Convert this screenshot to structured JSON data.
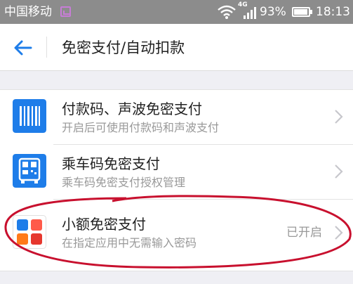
{
  "status_bar": {
    "carrier": "中国移动",
    "network": "4G",
    "battery": "93%",
    "battery_level": 0.93,
    "time": "18:13",
    "icons": [
      "app-notification-icon",
      "wifi-icon",
      "cell-signal-icon",
      "battery-icon"
    ]
  },
  "header": {
    "back_icon": "back-arrow-icon",
    "title": "免密支付/自动扣款"
  },
  "rows": [
    {
      "icon": "barcode-icon",
      "title": "付款码、声波免密支付",
      "subtitle": "开启后可使用付款码和声波支付",
      "status": ""
    },
    {
      "icon": "bus-code-icon",
      "title": "乘车码免密支付",
      "subtitle": "乘车码免密支付授权管理",
      "status": ""
    },
    {
      "icon": "app-grid-icon",
      "title": "小额免密支付",
      "subtitle": "在指定应用中无需输入密码",
      "status": "已开启"
    }
  ],
  "colors": {
    "accent_blue": "#1e7de9",
    "status_bar_bg": "#8c8c8c",
    "page_bg": "#efeff4",
    "annotation_red": "#c8102e"
  }
}
